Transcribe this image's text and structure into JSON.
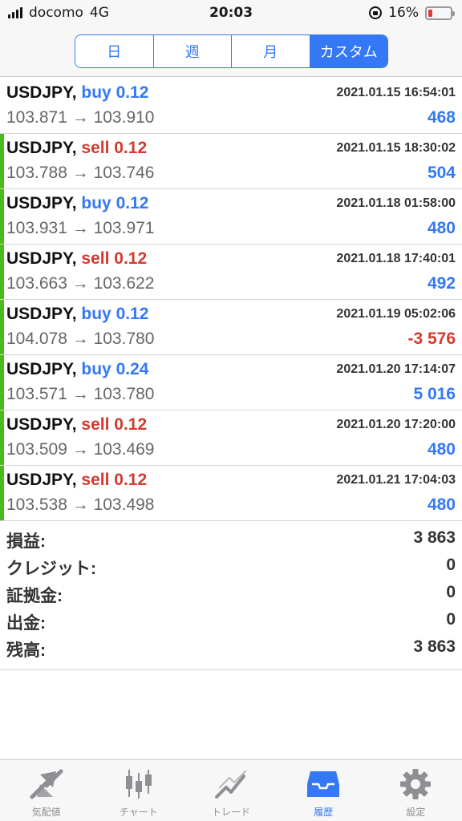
{
  "status": {
    "carrier": "docomo",
    "network": "4G",
    "time": "20:03",
    "battery": "16%"
  },
  "segments": [
    {
      "label": "日",
      "active": false
    },
    {
      "label": "週",
      "active": false
    },
    {
      "label": "月",
      "active": false
    },
    {
      "label": "カスタム",
      "active": true
    }
  ],
  "trades": [
    {
      "symbol": "USDJPY,",
      "side": "buy",
      "volume": "0.12",
      "datetime": "2021.01.15 16:54:01",
      "prices": "103.871 → 103.910",
      "profit": "468",
      "profit_sign": "pos",
      "left_bar": false
    },
    {
      "symbol": "USDJPY,",
      "side": "sell",
      "volume": "0.12",
      "datetime": "2021.01.15 18:30:02",
      "prices": "103.788 → 103.746",
      "profit": "504",
      "profit_sign": "pos",
      "left_bar": true
    },
    {
      "symbol": "USDJPY,",
      "side": "buy",
      "volume": "0.12",
      "datetime": "2021.01.18 01:58:00",
      "prices": "103.931 → 103.971",
      "profit": "480",
      "profit_sign": "pos",
      "left_bar": true
    },
    {
      "symbol": "USDJPY,",
      "side": "sell",
      "volume": "0.12",
      "datetime": "2021.01.18 17:40:01",
      "prices": "103.663 → 103.622",
      "profit": "492",
      "profit_sign": "pos",
      "left_bar": true
    },
    {
      "symbol": "USDJPY,",
      "side": "buy",
      "volume": "0.12",
      "datetime": "2021.01.19 05:02:06",
      "prices": "104.078 → 103.780",
      "profit": "-3 576",
      "profit_sign": "neg",
      "left_bar": true
    },
    {
      "symbol": "USDJPY,",
      "side": "buy",
      "volume": "0.24",
      "datetime": "2021.01.20 17:14:07",
      "prices": "103.571 → 103.780",
      "profit": "5 016",
      "profit_sign": "pos",
      "left_bar": true
    },
    {
      "symbol": "USDJPY,",
      "side": "sell",
      "volume": "0.12",
      "datetime": "2021.01.20 17:20:00",
      "prices": "103.509 → 103.469",
      "profit": "480",
      "profit_sign": "pos",
      "left_bar": true
    },
    {
      "symbol": "USDJPY,",
      "side": "sell",
      "volume": "0.12",
      "datetime": "2021.01.21 17:04:03",
      "prices": "103.538 → 103.498",
      "profit": "480",
      "profit_sign": "pos",
      "left_bar": true
    }
  ],
  "summary": [
    {
      "label": "損益:",
      "value": "3 863"
    },
    {
      "label": "クレジット:",
      "value": "0"
    },
    {
      "label": "証拠金:",
      "value": "0"
    },
    {
      "label": "出金:",
      "value": "0"
    },
    {
      "label": "残高:",
      "value": "3 863"
    }
  ],
  "tabs": [
    {
      "label": "気配値",
      "icon": "quotes-icon",
      "active": false
    },
    {
      "label": "チャート",
      "icon": "chart-icon",
      "active": false
    },
    {
      "label": "トレード",
      "icon": "trade-icon",
      "active": false
    },
    {
      "label": "履歴",
      "icon": "history-icon",
      "active": true
    },
    {
      "label": "設定",
      "icon": "settings-icon",
      "active": false
    }
  ],
  "colors": {
    "accent": "#3478f6",
    "sell": "#d43a2f",
    "bar": "#4cbb17"
  }
}
